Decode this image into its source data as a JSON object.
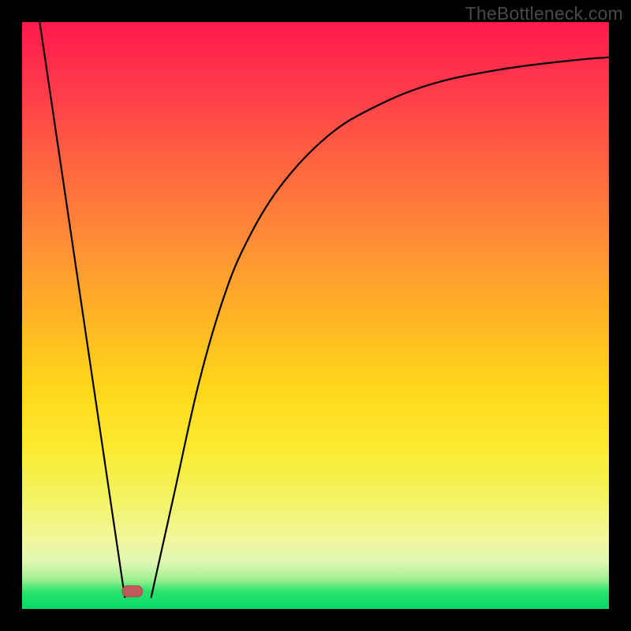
{
  "watermark": "TheBottleneck.com",
  "chart_data": {
    "type": "line",
    "title": "",
    "xlabel": "",
    "ylabel": "",
    "xlim": [
      0,
      100
    ],
    "ylim": [
      0,
      100
    ],
    "series": [
      {
        "name": "descending-line",
        "x": [
          3,
          17.5
        ],
        "y": [
          100,
          2
        ]
      },
      {
        "name": "ascending-curve",
        "x": [
          22,
          26,
          30,
          34,
          38,
          44,
          52,
          60,
          70,
          82,
          94,
          100
        ],
        "y": [
          2,
          20,
          38,
          52,
          62,
          72,
          80.5,
          85.5,
          89.5,
          92,
          93.5,
          94
        ]
      }
    ],
    "markers": [
      {
        "name": "min-marker",
        "x": 18.8,
        "y": 3.0
      }
    ],
    "gradient_stops": [
      {
        "pos": 0,
        "color": "#ff1a4d"
      },
      {
        "pos": 50,
        "color": "#ffd61a"
      },
      {
        "pos": 100,
        "color": "#05d967"
      }
    ]
  }
}
